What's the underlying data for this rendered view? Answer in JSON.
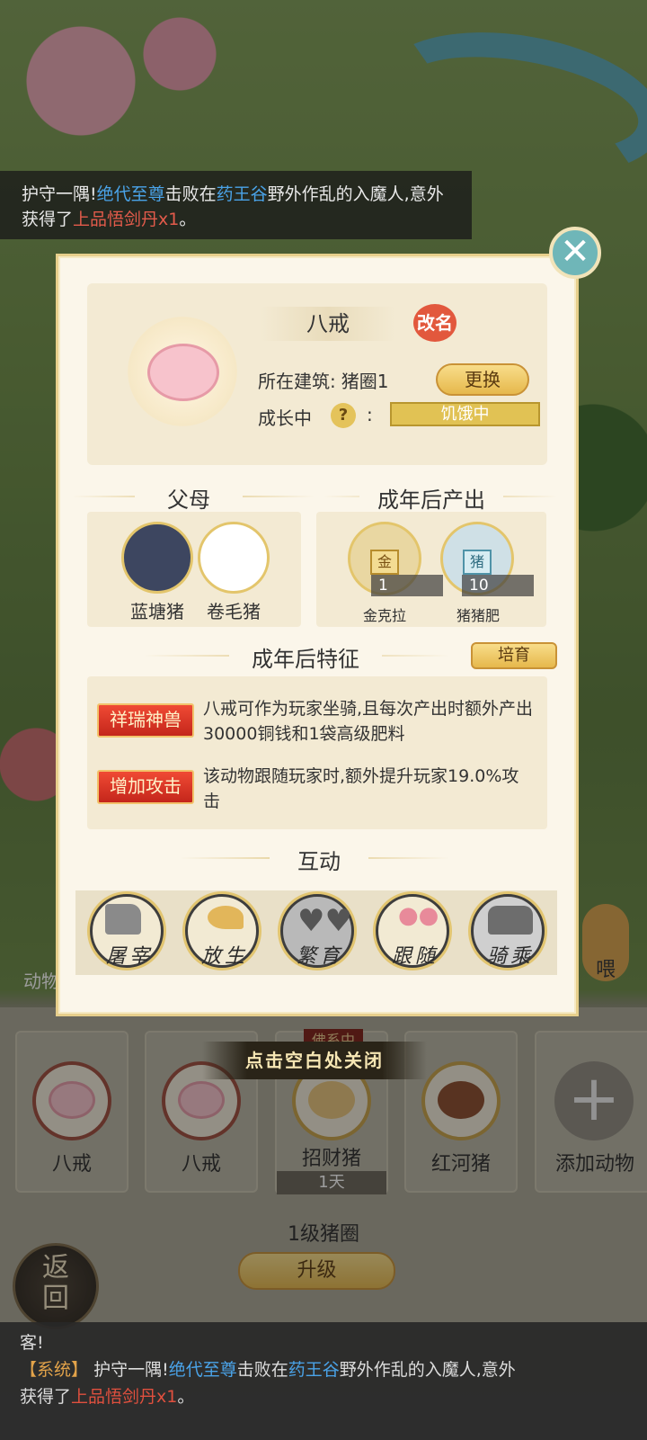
{
  "ticker": {
    "prefix": "护守一隅!",
    "player": "绝代至尊",
    "mid": "击败在",
    "place": "药王谷",
    "rest": "野外作乱的入魔人,",
    "obtained_prefix": "意外获得了",
    "item": "上品悟剑丹x1",
    "suffix": "。"
  },
  "modal": {
    "close_icon": "close-x-icon",
    "pet_name": "八戒",
    "rename_label": "改名",
    "building_label": "所在建筑:",
    "building_value": "猪圈1",
    "change_label": "更换",
    "growth_label": "成长中",
    "colon": ":",
    "status_value": "饥饿中",
    "parents_title": "父母",
    "parents": [
      {
        "name": "蓝塘猪",
        "icon": "black-pig-icon"
      },
      {
        "name": "卷毛猪",
        "icon": "white-curly-pig-icon"
      }
    ],
    "output_title": "成年后产出",
    "outputs": [
      {
        "name": "金克拉",
        "count": "1",
        "tag": "金"
      },
      {
        "name": "猪猪肥",
        "count": "10",
        "tag": "猪"
      }
    ],
    "traits_title": "成年后特征",
    "breed_label": "培育",
    "traits": [
      {
        "badge": "祥瑞神兽",
        "text": "八戒可作为玩家坐骑,且每次产出时额外产出30000铜钱和1袋高级肥料"
      },
      {
        "badge": "增加攻击",
        "text": "该动物跟随玩家时,额外提升玩家19.0%攻击"
      }
    ],
    "interact_title": "互动",
    "interactions": [
      {
        "label": "屠宰",
        "icon": "cleaver-icon"
      },
      {
        "label": "放生",
        "icon": "bird-icon"
      },
      {
        "label": "繁育",
        "icon": "hearts-icon"
      },
      {
        "label": "跟随",
        "icon": "paw-icon"
      },
      {
        "label": "骑乘",
        "icon": "saddle-icon"
      }
    ]
  },
  "close_hint": "点击空白处关闭",
  "pen": {
    "side_label": "动物",
    "feed_label": "喂",
    "slots": [
      {
        "name": "八戒"
      },
      {
        "name": "八戒"
      },
      {
        "name": "招财猪",
        "tag": "佛系中",
        "timer": "1天"
      },
      {
        "name": "红河猪"
      },
      {
        "name": "添加动物"
      }
    ],
    "level_label": "1级猪圈",
    "upgrade_label": "升级",
    "back_label": "返回"
  },
  "chat": {
    "line1": "客!",
    "sys": "【系统】",
    "text1": "护守一隅!",
    "player": "绝代至尊",
    "text2": "击败在",
    "place": "药王谷",
    "text3": "野外作乱的入魔人,意外",
    "text4": "获得了",
    "item": "上品悟剑丹x1",
    "end": "。"
  }
}
